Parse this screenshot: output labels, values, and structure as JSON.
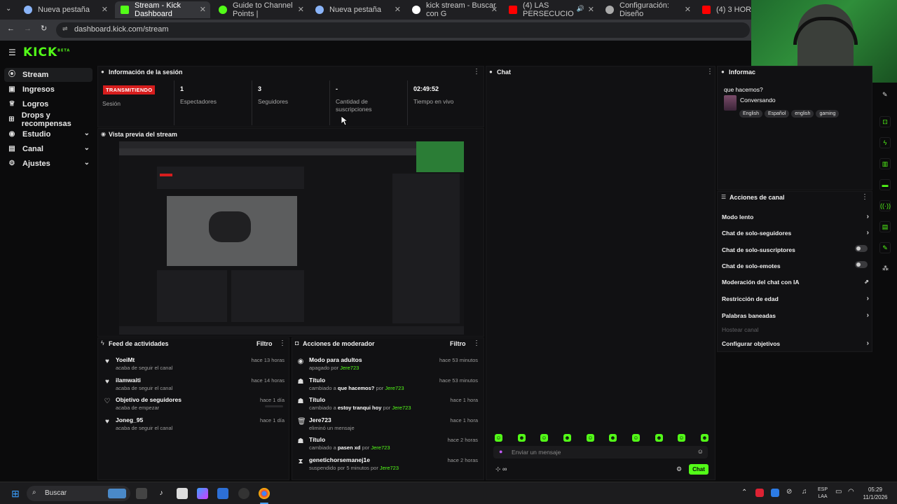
{
  "browser": {
    "tabs": [
      {
        "label": "Nueva pestaña",
        "color": "#8ab4f8"
      },
      {
        "label": "Stream - Kick Dashboard",
        "color": "#53fc18"
      },
      {
        "label": "Guide to Channel Points |",
        "color": "#53fc18"
      },
      {
        "label": "Nueva pestaña",
        "color": "#8ab4f8"
      },
      {
        "label": "kick stream - Buscar con G",
        "color": "#ffffff"
      },
      {
        "label": "(4) LAS PERSECUCIO",
        "color": "#ff0000"
      },
      {
        "label": "Configuración: Diseño",
        "color": "#aaaaaa"
      },
      {
        "label": "(4) 3 HORAS DE",
        "color": "#ff0000"
      }
    ],
    "url": "dashboard.kick.com/stream"
  },
  "header": {
    "logo": "KICK",
    "logo_sup": "BETA"
  },
  "sidebar": {
    "items": [
      {
        "label": "Stream",
        "icon": "stream-icon"
      },
      {
        "label": "Ingresos",
        "icon": "wallet-icon"
      },
      {
        "label": "Logros",
        "icon": "trophy-icon"
      },
      {
        "label": "Drops y recompensas",
        "icon": "gift-icon"
      },
      {
        "label": "Estudio",
        "icon": "studio-icon"
      },
      {
        "label": "Canal",
        "icon": "channel-icon"
      },
      {
        "label": "Ajustes",
        "icon": "gear-icon"
      }
    ]
  },
  "session": {
    "title": "Información de la sesión",
    "live_badge": "TRANSMITIENDO",
    "session_label": "Sesión",
    "viewers": {
      "value": "1",
      "label": "Espectadores"
    },
    "followers": {
      "value": "3",
      "label": "Seguidores"
    },
    "subs": {
      "value": "-",
      "label_1": "Cantidad de",
      "label_2": "suscripciones"
    },
    "live_time": {
      "value": "02:49:52",
      "label": "Tiempo en vivo"
    }
  },
  "preview": {
    "title": "Vista previa del stream"
  },
  "chat": {
    "title": "Chat",
    "placeholder": "Enviar un mensaje",
    "send_label": "Chat"
  },
  "info": {
    "title": "Informac",
    "stream_title": "que hacemos?",
    "category": "Conversando",
    "tags": [
      "English",
      "Español",
      "english",
      "gaming"
    ]
  },
  "activity": {
    "title": "Feed de actividades",
    "filter": "Filtro",
    "items": [
      {
        "name": "YoeiMt",
        "sub": "acaba de seguir el canal",
        "time": "hace 13 horas"
      },
      {
        "name": "ilamwaiti",
        "sub": "acaba de seguir el canal",
        "time": "hace 14 horas"
      },
      {
        "name": "Objetivo de seguidores",
        "sub": "acaba de empezar",
        "time": "hace 1 día"
      },
      {
        "name": "Joneg_95",
        "sub": "acaba de seguir el canal",
        "time": "hace 1 día"
      }
    ]
  },
  "modactions": {
    "title": "Acciones de moderador",
    "filter": "Filtro",
    "items": [
      {
        "name": "Modo para adultos",
        "sub_pre": "apagado por ",
        "sub_bold": "",
        "sub_mid": "",
        "user": "Jere723",
        "time": "hace 53 minutos"
      },
      {
        "name": "Título",
        "sub_pre": "cambiado a ",
        "sub_bold": "que hacemos?",
        "sub_mid": " por ",
        "user": "Jere723",
        "time": "hace 53 minutos"
      },
      {
        "name": "Título",
        "sub_pre": "cambiado a ",
        "sub_bold": "estoy tranqui hoy",
        "sub_mid": " por ",
        "user": "Jere723",
        "time": "hace 1 hora"
      },
      {
        "name": "Jere723",
        "sub_pre": "eliminó un mensaje",
        "sub_bold": "",
        "sub_mid": "",
        "user": "",
        "time": "hace 1 hora"
      },
      {
        "name": "Título",
        "sub_pre": "cambiado a ",
        "sub_bold": "pasen xd",
        "sub_mid": " por ",
        "user": "Jere723",
        "time": "hace 2 horas"
      },
      {
        "name": "genetichorsemanej1e",
        "sub_pre": "suspendido por 5 minutos por ",
        "sub_bold": "",
        "sub_mid": "",
        "user": "Jere723",
        "time": "hace 2 horas"
      }
    ]
  },
  "channel_actions": {
    "title": "Acciones de canal",
    "items": [
      {
        "label": "Modo lento"
      },
      {
        "label": "Chat de solo-seguidores"
      },
      {
        "label": "Chat de solo-suscriptores"
      },
      {
        "label": "Chat de solo-emotes"
      },
      {
        "label": "Moderación del chat con IA"
      },
      {
        "label": "Restricción de edad"
      },
      {
        "label": "Palabras baneadas"
      },
      {
        "label": "Hostear canal"
      },
      {
        "label": "Configurar objetivos"
      }
    ]
  },
  "taskbar": {
    "search": "Buscar",
    "lang_1": "ESP",
    "lang_2": "LAA",
    "time": "05:29",
    "date": "11/1/2026"
  },
  "colors": {
    "accent": "#53fc18",
    "live": "#d71d1d",
    "bg": "#0b0b0c",
    "panel": "#111113"
  }
}
